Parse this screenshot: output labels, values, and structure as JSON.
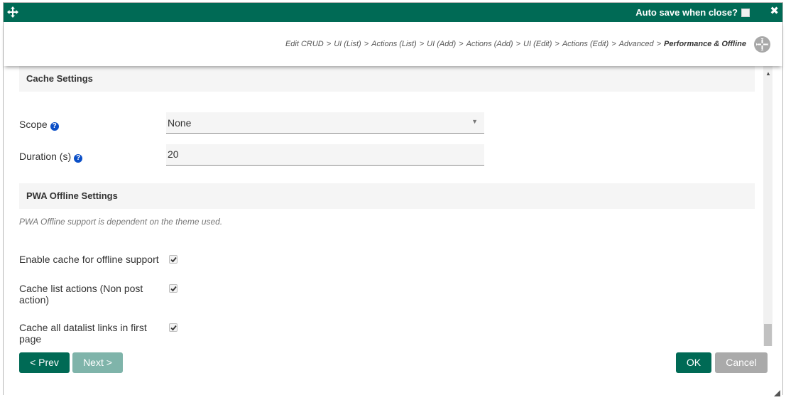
{
  "titlebar": {
    "autosave_label": "Auto save when close?",
    "close_symbol": "✖",
    "icons": [
      "move-icon",
      "close-icon"
    ]
  },
  "breadcrumb": {
    "items": [
      "Edit CRUD",
      "UI (List)",
      "Actions (List)",
      "UI (Add)",
      "Actions (Add)",
      "UI (Edit)",
      "Actions (Edit)",
      "Advanced",
      "Performance & Offline"
    ],
    "separator": ">"
  },
  "cache_settings": {
    "heading": "Cache Settings",
    "scope": {
      "label": "Scope",
      "value": "None"
    },
    "duration": {
      "label": "Duration (s)",
      "value": "20"
    }
  },
  "pwa_settings": {
    "heading": "PWA Offline Settings",
    "note": "PWA Offline support is dependent on the theme used.",
    "options": [
      {
        "label": "Enable cache for offline support",
        "checked": true
      },
      {
        "label": "Cache list actions (Non post action)",
        "checked": true
      },
      {
        "label": "Cache all datalist links in first page",
        "checked": true
      }
    ]
  },
  "footer": {
    "prev_label": "< Prev",
    "next_label": "Next >",
    "ok_label": "OK",
    "cancel_label": "Cancel"
  },
  "colors": {
    "primary": "#006a55",
    "disabled_primary": "#7fb4aa",
    "cancel": "#aaaaaa",
    "help": "#0b4fc7"
  }
}
